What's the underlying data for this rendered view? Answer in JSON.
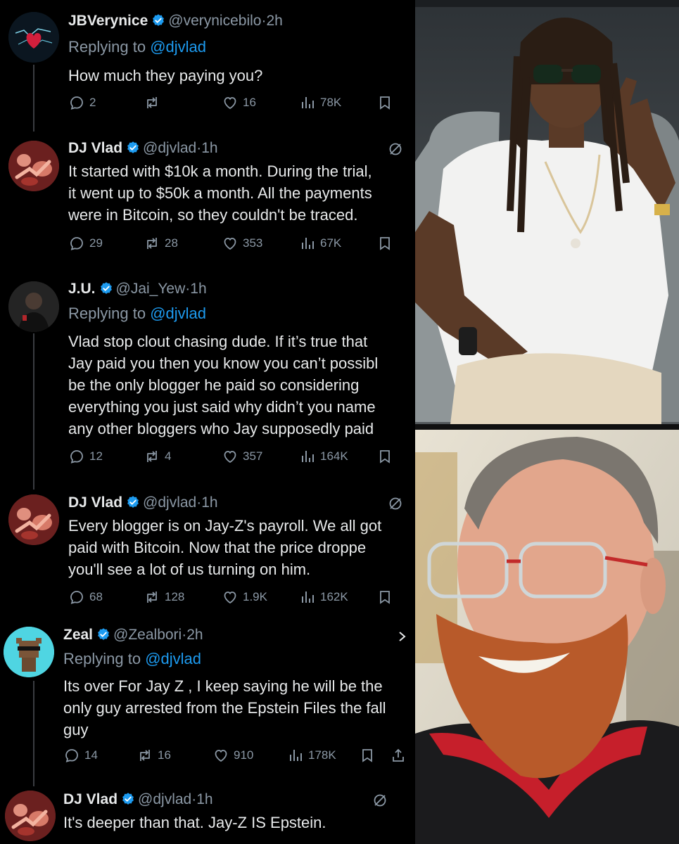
{
  "tweets": [
    {
      "name": "JBVerynice",
      "handle": "@verynicebilo",
      "time": "2h",
      "reply_prefix": "Replying to",
      "reply_to": "@djvlad",
      "lines": [
        "How much they paying you?"
      ],
      "replies": "2",
      "reposts": "",
      "likes": "16",
      "views": "78K"
    },
    {
      "name": "DJ Vlad",
      "handle": "@djvlad",
      "time": "1h",
      "lines": [
        "It started with $10k a month.  During the trial,",
        "it went up to $50k a month.  All the payments",
        "were in Bitcoin, so they couldn't be traced."
      ],
      "replies": "29",
      "reposts": "28",
      "likes": "353",
      "views": "67K"
    },
    {
      "name": "J.U.",
      "handle": "@Jai_Yew",
      "time": "1h",
      "reply_prefix": "Replying to",
      "reply_to": "@djvlad",
      "lines": [
        "Vlad stop clout chasing dude. If it’s true that",
        "Jay paid you then you know you can’t possibl",
        "be the only blogger he paid so considering",
        "everything you just said why didn’t you name",
        "any other bloggers who Jay supposedly paid"
      ],
      "replies": "12",
      "reposts": "4",
      "likes": "357",
      "views": "164K"
    },
    {
      "name": "DJ Vlad",
      "handle": "@djvlad",
      "time": "1h",
      "lines": [
        "Every blogger is on Jay-Z's payroll.  We all got",
        "paid with Bitcoin.  Now that the price droppe",
        "you'll see a lot of us turning on him."
      ],
      "replies": "68",
      "reposts": "128",
      "likes": "1.9K",
      "views": "162K"
    },
    {
      "name": "Zeal",
      "handle": "@Zealbori",
      "time": "2h",
      "reply_prefix": "Replying to",
      "reply_to": "@djvlad",
      "lines": [
        "Its over For Jay Z , I keep saying he will be the",
        "only guy arrested from the Epstein Files the fall",
        "guy"
      ],
      "replies": "14",
      "reposts": "16",
      "likes": "910",
      "views": "178K"
    },
    {
      "name": "DJ Vlad",
      "handle": "@djvlad",
      "time": "1h",
      "lines": [
        "It's deeper than that.  Jay-Z IS Epstein."
      ]
    }
  ],
  "colors": {
    "background": "#000000",
    "text": "#e7e9ea",
    "muted": "#8b98a5",
    "link": "#1d9bf0",
    "verified": "#1d9bf0"
  },
  "icons": [
    "reply-icon",
    "repost-icon",
    "like-icon",
    "views-icon",
    "bookmark-icon",
    "verified-badge-icon",
    "grok-icon",
    "more-icon"
  ]
}
